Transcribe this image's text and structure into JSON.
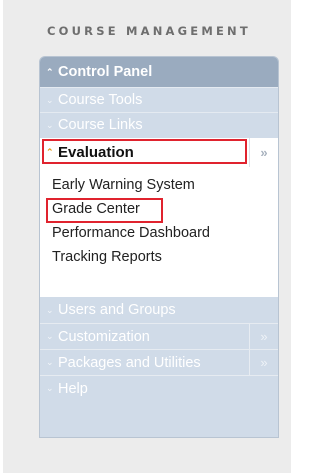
{
  "section_title": "COURSE MANAGEMENT",
  "control_panel": {
    "header_label": "Control Panel",
    "items": [
      {
        "label": "Course Tools"
      },
      {
        "label": "Course Links"
      }
    ],
    "evaluation": {
      "label": "Evaluation",
      "arrow": "»",
      "highlighted": true,
      "subitems": [
        {
          "label": "Early Warning System"
        },
        {
          "label": "Grade Center",
          "highlighted": true
        },
        {
          "label": "Performance Dashboard"
        },
        {
          "label": "Tracking Reports"
        }
      ]
    },
    "lower_items": [
      {
        "label": "Users and Groups"
      },
      {
        "label": "Customization",
        "arrow": "»"
      },
      {
        "label": "Packages and Utilities",
        "arrow": "»"
      },
      {
        "label": "Help"
      }
    ]
  },
  "colors": {
    "panel_bg": "#d0dbe8",
    "header_bg": "#9aabbf",
    "highlight_border": "#e0232e",
    "expanded_chevron": "#e39a1a"
  }
}
